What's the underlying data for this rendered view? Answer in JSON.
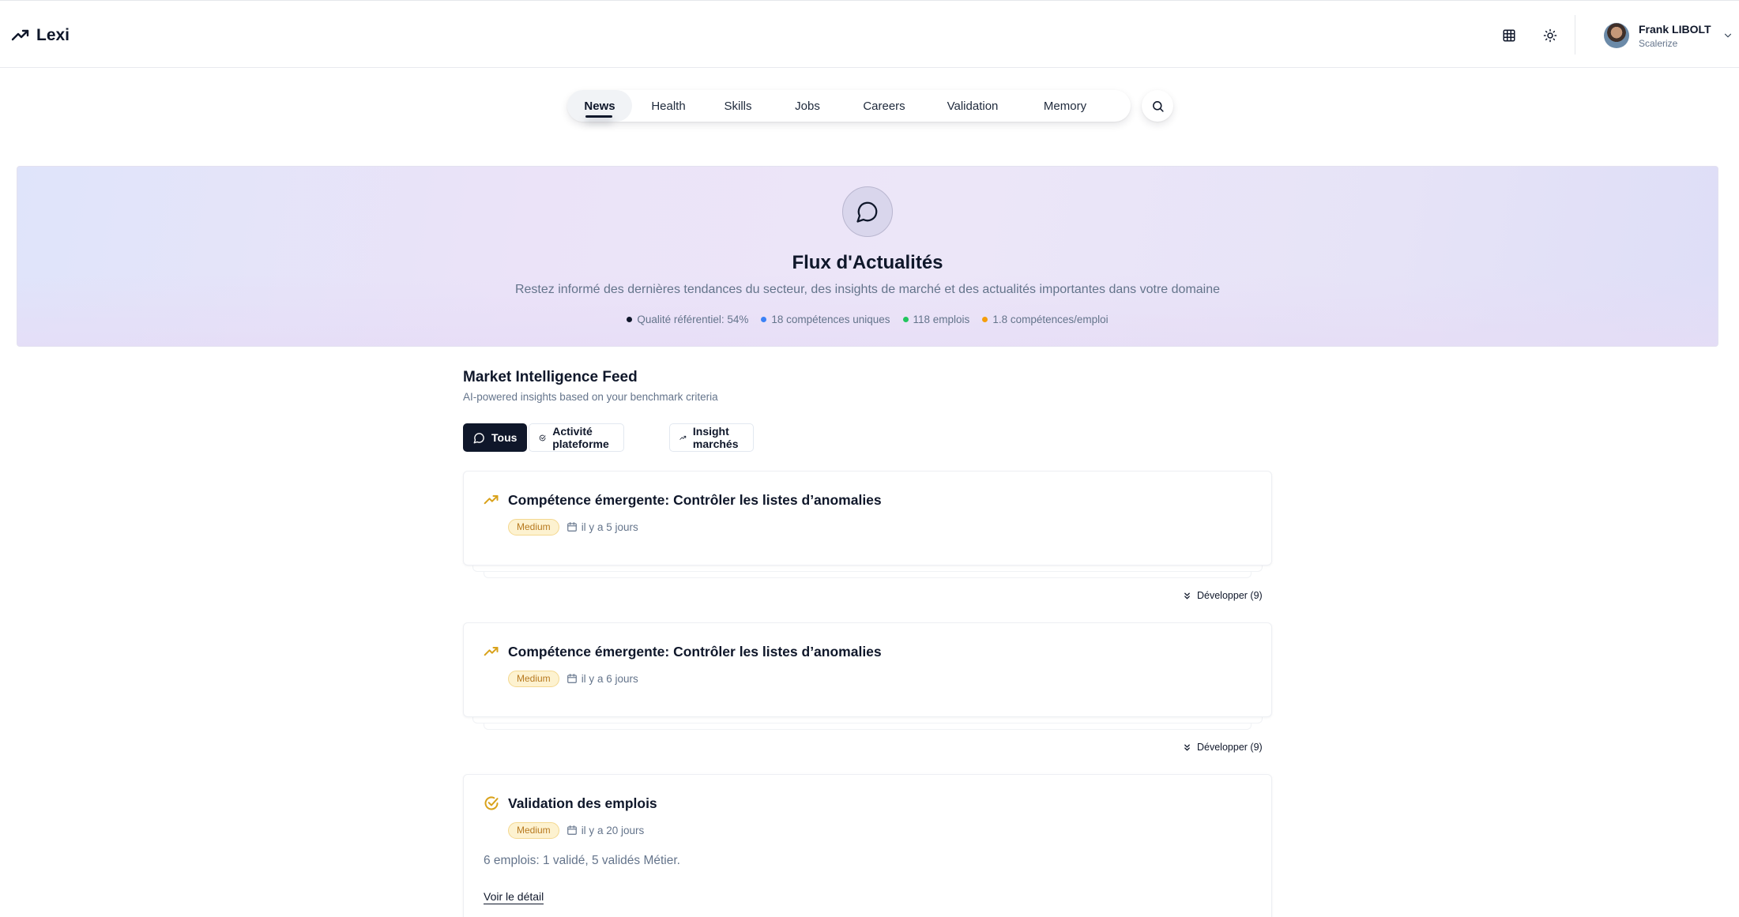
{
  "app": {
    "name": "Lexi"
  },
  "header": {
    "icons": [
      "grid-icon",
      "sun-icon"
    ],
    "user": {
      "name": "Frank LIBOLT",
      "org": "Scalerize"
    }
  },
  "nav": {
    "items": [
      {
        "label": "News",
        "active": true
      },
      {
        "label": "Health"
      },
      {
        "label": "Skills"
      },
      {
        "label": "Jobs"
      },
      {
        "label": "Careers"
      },
      {
        "label": "Validation"
      },
      {
        "label": "Memory"
      }
    ]
  },
  "hero": {
    "title": "Flux d'Actualités",
    "subtitle": "Restez informé des dernières tendances du secteur, des insights de marché et des actualités importantes dans votre domaine",
    "stats": [
      {
        "label": "Qualité référentiel: 54%",
        "color": "#0f172a"
      },
      {
        "label": "18 compétences uniques",
        "color": "#3b82f6"
      },
      {
        "label": "118 emplois",
        "color": "#22c55e"
      },
      {
        "label": "1.8 compétences/emploi",
        "color": "#f59e0b"
      }
    ]
  },
  "feed": {
    "title": "Market Intelligence Feed",
    "subtitle": "AI-powered insights based on your benchmark criteria",
    "filters": [
      {
        "label": "Tous",
        "active": true
      },
      {
        "label": "Activité plateforme"
      },
      {
        "label": "Insight marchés"
      }
    ],
    "cards": [
      {
        "title": "Compétence émergente: Contrôler les listes d’anomalies",
        "badge": "Medium",
        "date": "il y a 5 jours",
        "expand": "Développer (9)"
      },
      {
        "title": "Compétence émergente: Contrôler les listes d’anomalies",
        "badge": "Medium",
        "date": "il y a 6 jours",
        "expand": "Développer (9)"
      },
      {
        "title": "Validation des emplois",
        "badge": "Medium",
        "date": "il y a 20 jours",
        "description": "6 emplois: 1 validé, 5 validés Métier.",
        "link": "Voir le détail"
      }
    ]
  },
  "colors": {
    "accent": "#0f172a",
    "warning": "#d9a21b",
    "badge_bg": "#fdf2d0",
    "badge_text": "#b7791f"
  }
}
